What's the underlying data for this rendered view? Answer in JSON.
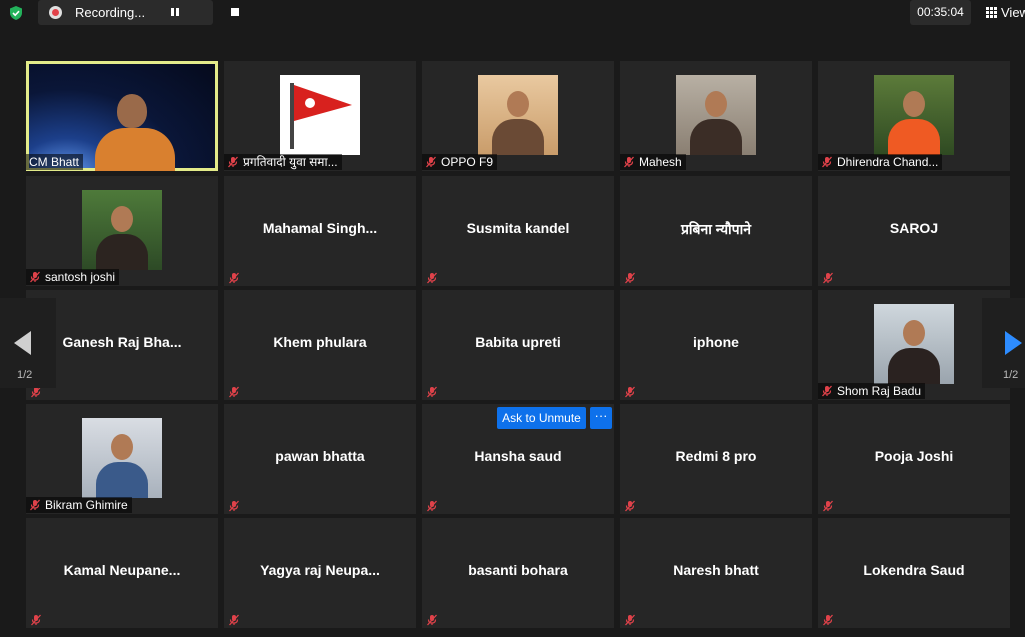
{
  "topbar": {
    "recording_label": "Recording...",
    "timer": "00:35:04",
    "view_label": "View"
  },
  "colors": {
    "active_speaker_border": "#e3eb8a",
    "accent_blue": "#0e71eb",
    "mute_red": "#e0424a",
    "background": "#1a1a1a",
    "tile": "#262626"
  },
  "pagination": {
    "left": "1/2",
    "right": "1/2"
  },
  "ask_to_unmute": {
    "label": "Ask to Unmute",
    "more": "···"
  },
  "participants": [
    {
      "name": "CM Bhatt",
      "video": true,
      "muted": false,
      "active": true
    },
    {
      "name": "प्रगतिवादी युवा समा...",
      "video": true,
      "muted": true
    },
    {
      "name": "OPPO F9",
      "video": true,
      "muted": true
    },
    {
      "name": "Mahesh",
      "video": true,
      "muted": true
    },
    {
      "name": "Dhirendra Chand...",
      "video": true,
      "muted": true
    },
    {
      "name": "santosh joshi",
      "video": true,
      "muted": true
    },
    {
      "name": "Mahamal  Singh...",
      "video": false,
      "muted": true
    },
    {
      "name": "Susmita kandel",
      "video": false,
      "muted": true
    },
    {
      "name": "प्रबिना न्यौपाने",
      "video": false,
      "muted": true
    },
    {
      "name": "SAROJ",
      "video": false,
      "muted": true
    },
    {
      "name": "Ganesh  Raj  Bha...",
      "video": false,
      "muted": true
    },
    {
      "name": "Khem phulara",
      "video": false,
      "muted": true
    },
    {
      "name": "Babita upreti",
      "video": false,
      "muted": true
    },
    {
      "name": "iphone",
      "video": false,
      "muted": true
    },
    {
      "name": "Shom Raj Badu",
      "video": true,
      "muted": true
    },
    {
      "name": "Bikram Ghimire",
      "video": true,
      "muted": true
    },
    {
      "name": "pawan bhatta",
      "video": false,
      "muted": true
    },
    {
      "name": "Hansha saud",
      "video": false,
      "muted": true
    },
    {
      "name": "Redmi 8 pro",
      "video": false,
      "muted": true
    },
    {
      "name": "Pooja Joshi",
      "video": false,
      "muted": true
    },
    {
      "name": "Kamal  Neupane...",
      "video": false,
      "muted": true
    },
    {
      "name": "Yagya  raj  Neupa...",
      "video": false,
      "muted": true
    },
    {
      "name": "basanti bohara",
      "video": false,
      "muted": true
    },
    {
      "name": "Naresh bhatt",
      "video": false,
      "muted": true
    },
    {
      "name": "Lokendra Saud",
      "video": false,
      "muted": true
    }
  ]
}
